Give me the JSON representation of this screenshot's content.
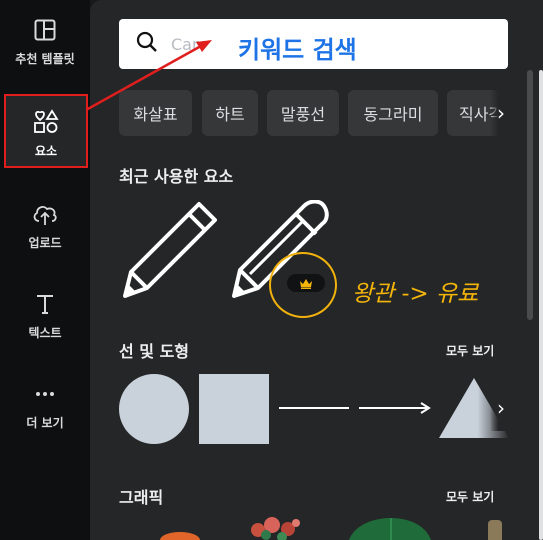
{
  "sidebar": {
    "items": [
      {
        "label": "추천 템플릿",
        "icon": "template-icon"
      },
      {
        "label": "요소",
        "icon": "elements-icon",
        "active": true
      },
      {
        "label": "업로드",
        "icon": "upload-icon"
      },
      {
        "label": "텍스트",
        "icon": "text-icon"
      },
      {
        "label": "더 보기",
        "icon": "more-icon"
      }
    ]
  },
  "search": {
    "placeholder": "Canva",
    "annotation": "키워드 검색"
  },
  "chips": [
    "화살표",
    "하트",
    "말풍선",
    "동그라미",
    "직사각"
  ],
  "recent": {
    "title": "최근 사용한 요소",
    "premium_annotation": "왕관 -> 유료"
  },
  "shapes": {
    "title": "선 및 도형",
    "see_all": "모두 보기"
  },
  "graphics": {
    "title": "그래픽",
    "see_all": "모두 보기"
  },
  "colors": {
    "highlight_red": "#e01e1e",
    "annotation_blue": "#1e74e6",
    "annotation_gold": "#f4b50a",
    "shape_fill": "#c9d1db"
  }
}
